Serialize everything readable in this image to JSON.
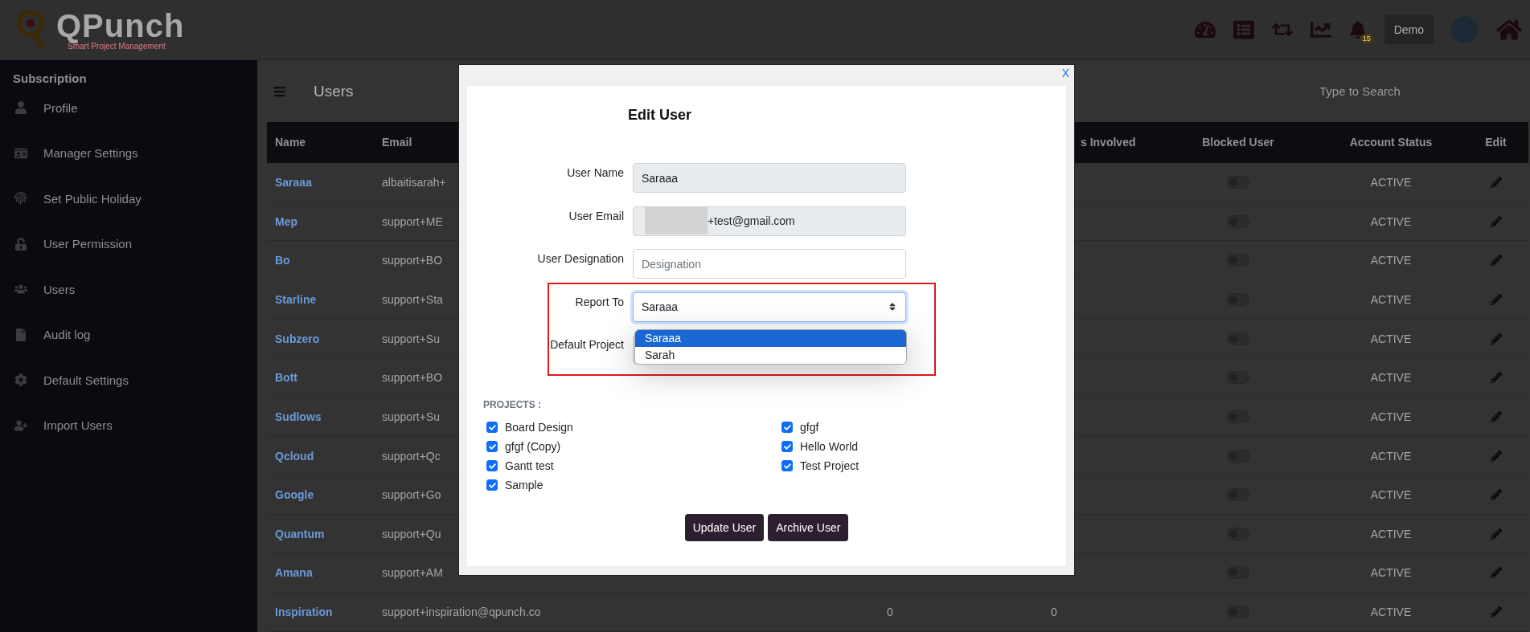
{
  "header": {
    "logo_title": "QPunch",
    "logo_subtitle": "Smart Project Management",
    "notification_count": "15",
    "user_button": "Demo"
  },
  "sidebar": {
    "title": "Subscription",
    "items": [
      {
        "label": "Profile"
      },
      {
        "label": "Manager Settings"
      },
      {
        "label": "Set Public Holiday"
      },
      {
        "label": "User Permission"
      },
      {
        "label": "Users"
      },
      {
        "label": "Audit log"
      },
      {
        "label": "Default Settings"
      },
      {
        "label": "Import Users"
      }
    ]
  },
  "page": {
    "title": "Users",
    "search": {
      "placeholder": "Type to Search"
    }
  },
  "table": {
    "columns": {
      "name": "Name",
      "email": "Email",
      "column_5": "s Involved",
      "blocked": "Blocked User",
      "status": "Account Status",
      "edit": "Edit"
    },
    "rows": [
      {
        "name": "Saraaa",
        "email": "albaitisarah+",
        "blocked": false,
        "status": "ACTIVE"
      },
      {
        "name": "Mep",
        "email": "support+ME",
        "blocked": false,
        "status": "ACTIVE"
      },
      {
        "name": "Bo",
        "email": "support+BO",
        "blocked": false,
        "status": "ACTIVE"
      },
      {
        "name": "Starline",
        "email": "support+Sta",
        "blocked": false,
        "status": "ACTIVE"
      },
      {
        "name": "Subzero",
        "email": "support+Su",
        "blocked": false,
        "status": "ACTIVE"
      },
      {
        "name": "Bott",
        "email": "support+BO",
        "blocked": false,
        "status": "ACTIVE"
      },
      {
        "name": "Sudlows",
        "email": "support+Su",
        "blocked": false,
        "status": "ACTIVE"
      },
      {
        "name": "Qcloud",
        "email": "support+Qc",
        "blocked": false,
        "status": "ACTIVE"
      },
      {
        "name": "Google",
        "email": "support+Go",
        "blocked": false,
        "status": "ACTIVE"
      },
      {
        "name": "Quantum",
        "email": "support+Qu",
        "blocked": false,
        "status": "ACTIVE"
      },
      {
        "name": "Amana",
        "email": "support+AM",
        "blocked": false,
        "status": "ACTIVE"
      },
      {
        "name": "Inspiration",
        "email": "support+inspiration@qpunch.co",
        "column_4": "0",
        "column_5": "0",
        "blocked": false,
        "status": "ACTIVE"
      }
    ]
  },
  "modal": {
    "close": "X",
    "title": "Edit User",
    "fields": [
      {
        "label": "User Name",
        "value": "Saraaa",
        "readonly": true
      },
      {
        "label": "User Email",
        "value": "+test@gmail.com",
        "readonly": true,
        "redacted": true
      },
      {
        "label": "User Designation",
        "placeholder": "Designation",
        "readonly": false
      }
    ],
    "report_to": {
      "label": "Report To",
      "value": "Saraaa",
      "options": [
        {
          "label": "Saraaa",
          "selected": true
        },
        {
          "label": "Sarah",
          "selected": false
        }
      ]
    },
    "default_project": {
      "label": "Default Project"
    },
    "projects_title": "PROJECTS :",
    "projects": [
      {
        "label": "Board Design",
        "checked": true
      },
      {
        "label": "gfgf",
        "checked": true
      },
      {
        "label": "gfgf (Copy)",
        "checked": true
      },
      {
        "label": "Hello World",
        "checked": true
      },
      {
        "label": "Gantt test",
        "checked": true
      },
      {
        "label": "Test Project",
        "checked": true
      },
      {
        "label": "Sample",
        "checked": true
      }
    ],
    "buttons": [
      "Update User",
      "Archive User"
    ]
  }
}
